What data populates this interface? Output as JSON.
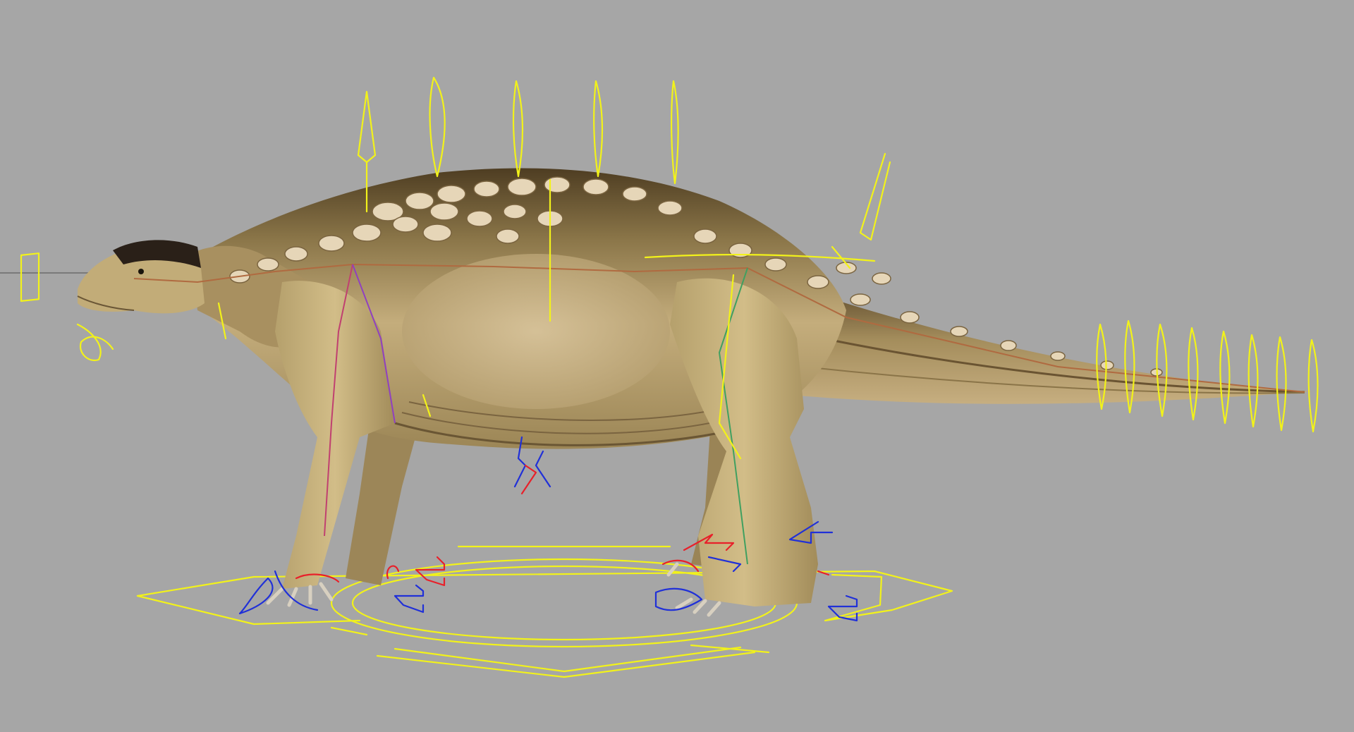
{
  "viewport": {
    "background": "#a6a6a6",
    "view": "side"
  },
  "model": {
    "subject": "armored-quadruped-dinosaur",
    "colors": {
      "skin_light": "#c8b47e",
      "skin_mid": "#a08a58",
      "skin_dark": "#5a4628",
      "back_dark": "#4a3a20",
      "scute": "#e6d6b8",
      "head_cap": "#2a2018"
    }
  },
  "rig": {
    "colors": {
      "controls": "#f2f21a",
      "left_side": "#e8202a",
      "right_side": "#2030d8"
    },
    "controls": [
      "spine-fk-controls",
      "tail-fk-controls",
      "root-move-control",
      "left-foot-ik",
      "right-foot-ik",
      "hip-control",
      "belly-control",
      "head-look-control"
    ]
  }
}
